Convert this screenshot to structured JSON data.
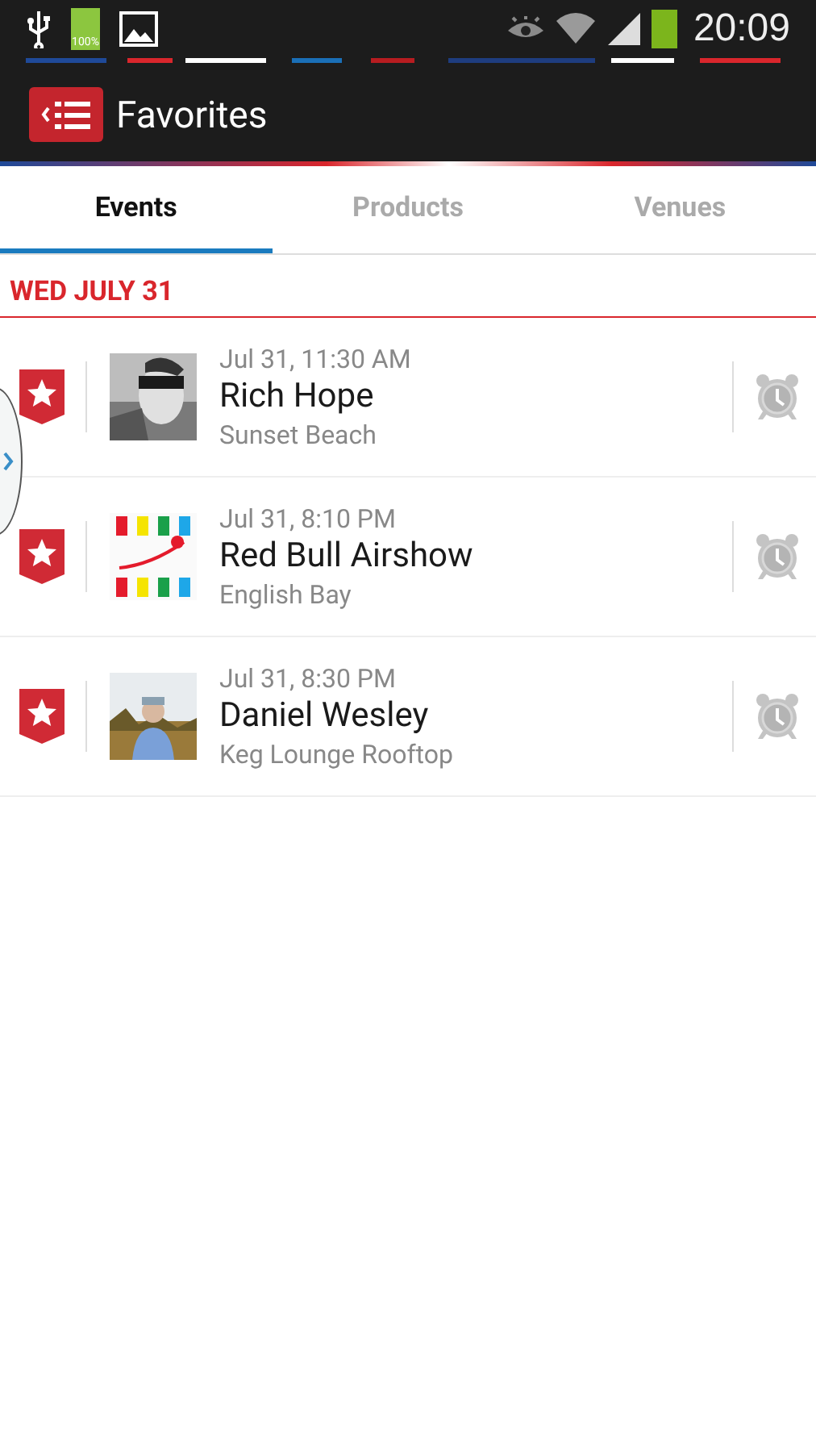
{
  "status_bar": {
    "battery_label": "100%",
    "time": "20:09"
  },
  "action_bar": {
    "title": "Favorites"
  },
  "tabs": [
    {
      "label": "Events",
      "selected": true
    },
    {
      "label": "Products",
      "selected": false
    },
    {
      "label": "Venues",
      "selected": false
    }
  ],
  "date_header": "WED JULY 31",
  "events": [
    {
      "time": "Jul 31, 11:30 AM",
      "title": "Rich Hope",
      "venue": "Sunset Beach",
      "favorite": true
    },
    {
      "time": "Jul 31, 8:10 PM",
      "title": "Red Bull Airshow",
      "venue": "English Bay",
      "favorite": true
    },
    {
      "time": "Jul 31, 8:30 PM",
      "title": "Daniel Wesley",
      "venue": "Keg Lounge Rooftop",
      "favorite": true
    }
  ]
}
